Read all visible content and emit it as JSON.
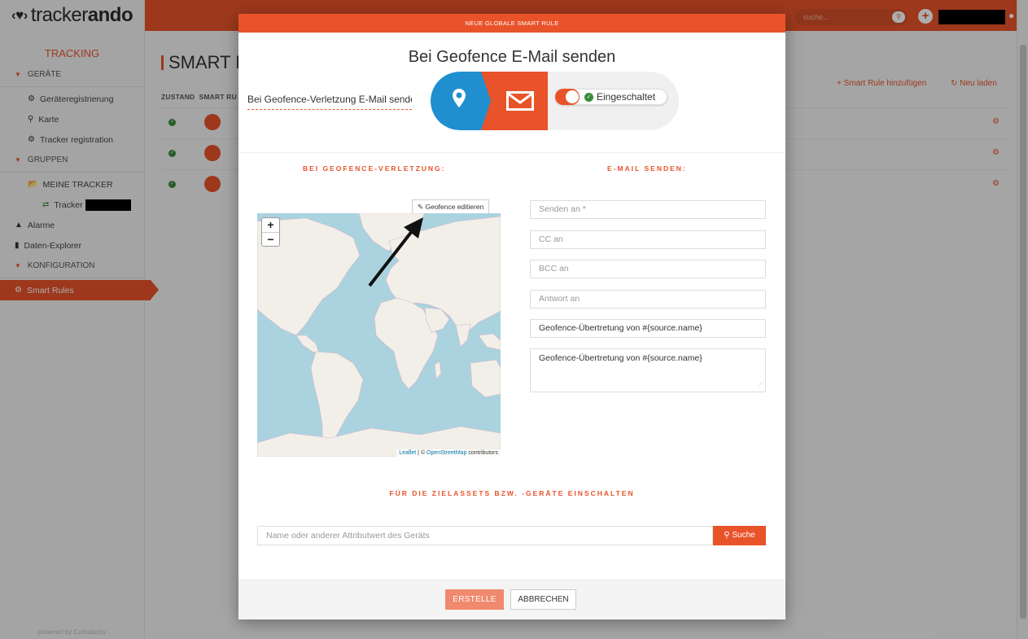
{
  "app": {
    "logo_prefix": "tracker",
    "logo_suffix": "ando",
    "search_placeholder": "suche...",
    "powered_by": "powered by Cumulocity"
  },
  "sidebar": {
    "section_title": "TRACKING",
    "groups": {
      "geraete": "GERÄTE",
      "gruppen": "GRUPPEN",
      "konfiguration": "KONFIGURATION"
    },
    "items": {
      "geraeteregistrierung": "Geräteregistrierung",
      "karte": "Karte",
      "tracker_registration": "Tracker registration",
      "meine_tracker": "MEINE TRACKER",
      "tracker": "Tracker",
      "alarme": "Alarme",
      "daten_explorer": "Daten-Explorer",
      "smart_rules": "Smart Rules"
    }
  },
  "background_page": {
    "title": "SMART RULES",
    "actions": {
      "add": "Smart Rule hinzufügen",
      "reload": "Neu laden"
    },
    "columns": [
      "ZUSTAND",
      "SMART RU"
    ]
  },
  "modal": {
    "header": "NEUE GLOBALE SMART RULE",
    "title": "Bei Geofence E-Mail senden",
    "rule_name": "Bei Geofence-Verletzung E-Mail senden",
    "toggle_label": "Eingeschaltet",
    "toggle_on": true,
    "left_heading": "BEI GEOFENCE-VERLETZUNG:",
    "right_heading": "E-MAIL SENDEN:",
    "geofence_button": "Geofence editieren",
    "map": {
      "zoom_in": "+",
      "zoom_out": "−",
      "attribution_leaflet": "Leaflet",
      "attribution_sep": " | © ",
      "attribution_osm": "OpenStreetMap",
      "attribution_tail": " contributors"
    },
    "email_fields": {
      "to_placeholder": "Senden an *",
      "cc_placeholder": "CC an",
      "bcc_placeholder": "BCC an",
      "reply_placeholder": "Antwort an",
      "subject_value": "Geofence-Übertretung von #{source.name}",
      "body_value": "Geofence-Übertretung von #{source.name}"
    },
    "assets_heading": "FÜR DIE ZIELASSETS BZW. -GERÄTE EINSCHALTEN",
    "asset_search_placeholder": "Name oder anderer Attributwert des Geräts",
    "asset_search_button": "Suche",
    "create_button": "ERSTELLE",
    "cancel_button": "ABBRECHEN"
  },
  "colors": {
    "accent": "#e8532a",
    "geofence_blue": "#1f8fd0",
    "ok_green": "#3a8a3a",
    "map_water": "#aad3df",
    "map_land": "#f2efe9"
  }
}
